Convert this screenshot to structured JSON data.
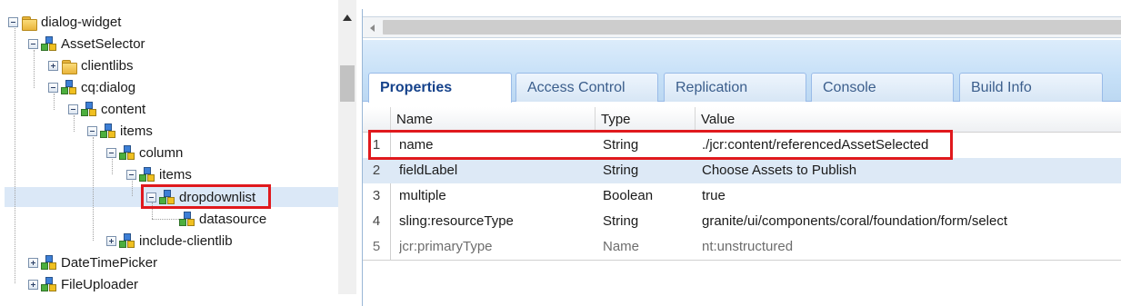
{
  "tree": {
    "nodes": [
      {
        "label": "dialog-widget",
        "icon": "folder-icon"
      },
      {
        "label": "AssetSelector",
        "icon": "component-icon"
      },
      {
        "label": "clientlibs",
        "icon": "folder-icon"
      },
      {
        "label": "cq:dialog",
        "icon": "component-icon"
      },
      {
        "label": "content",
        "icon": "component-icon"
      },
      {
        "label": "items",
        "icon": "component-icon"
      },
      {
        "label": "column",
        "icon": "component-icon"
      },
      {
        "label": "items",
        "icon": "component-icon"
      },
      {
        "label": "dropdownlist",
        "icon": "component-icon"
      },
      {
        "label": "datasource",
        "icon": "component-icon"
      },
      {
        "label": "include-clientlib",
        "icon": "component-icon"
      },
      {
        "label": "DateTimePicker",
        "icon": "component-icon"
      },
      {
        "label": "FileUploader",
        "icon": "component-icon"
      }
    ]
  },
  "tabs": [
    {
      "label": "Properties"
    },
    {
      "label": "Access Control"
    },
    {
      "label": "Replication"
    },
    {
      "label": "Console"
    },
    {
      "label": "Build Info"
    }
  ],
  "grid": {
    "columns": [
      "Name",
      "Type",
      "Value"
    ],
    "rows": [
      {
        "num": "1",
        "name": "name",
        "type": "String",
        "value": "./jcr:content/referencedAssetSelected"
      },
      {
        "num": "2",
        "name": "fieldLabel",
        "type": "String",
        "value": "Choose Assets to Publish"
      },
      {
        "num": "3",
        "name": "multiple",
        "type": "Boolean",
        "value": "true"
      },
      {
        "num": "4",
        "name": "sling:resourceType",
        "type": "String",
        "value": "granite/ui/components/coral/foundation/form/select"
      },
      {
        "num": "5",
        "name": "jcr:primaryType",
        "type": "Name",
        "value": "nt:unstructured"
      }
    ]
  },
  "colors": {
    "highlight_box": "#e0191d",
    "selection": "#dbe8f7",
    "tab_text": "#15428b"
  }
}
